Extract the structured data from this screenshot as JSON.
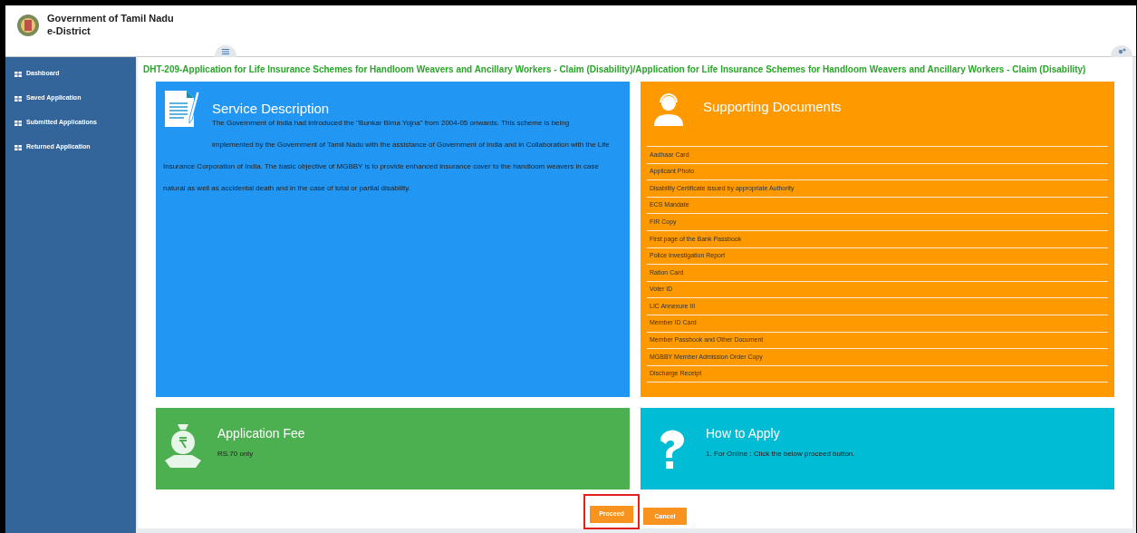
{
  "header": {
    "title": "Government of Tamil Nadu",
    "subtitle": "e-District"
  },
  "sidebar": {
    "items": [
      {
        "label": "Dashboard"
      },
      {
        "label": "Saved Application"
      },
      {
        "label": "Submitted Applications"
      },
      {
        "label": "Returned Application"
      }
    ]
  },
  "page_title": "DHT-209-Application for Life Insurance Schemes for Handloom Weavers and Ancillary Workers - Claim (Disability)/Application for Life Insurance Schemes for Handloom Weavers and Ancillary Workers - Claim (Disability)",
  "service_description": {
    "title": "Service Description",
    "text": "The Government of India had introduced the \"Bunkar Bima Yojna\" from 2004-05 onwards. This scheme is being implemented by the Government of Tamil Nadu with the assistance of Government of India and in Collaboration with the Life Insurance Corporation of India. The basic objective of MGBBY is to provide enhanced insurance cover to the handloom weavers in case natural as well as accidental death and in the case of total or partial disability."
  },
  "supporting_documents": {
    "title": "Supporting Documents",
    "items": [
      "Aadhaar Card",
      "Applicant Photo",
      "Disability Certificate issued by appropriate Authority",
      "ECS Mandate",
      "FIR Copy",
      "First page of the Bank Passbook",
      "Police Investigation Report",
      "Ration Card",
      "Voter ID",
      "LIC Annexure III",
      "Member ID Card",
      "Member Passbook and Other Document",
      "MGBBY Member Admission Order Copy",
      "Discharge Receipt"
    ]
  },
  "application_fee": {
    "title": "Application Fee",
    "text": "RS.70 only"
  },
  "how_to_apply": {
    "title": "How to Apply",
    "text": "1. For Online : Click the below proceed button."
  },
  "buttons": [
    {
      "label": "Proceed",
      "highlighted": true
    },
    {
      "label": "Cancel",
      "highlighted": false
    }
  ]
}
